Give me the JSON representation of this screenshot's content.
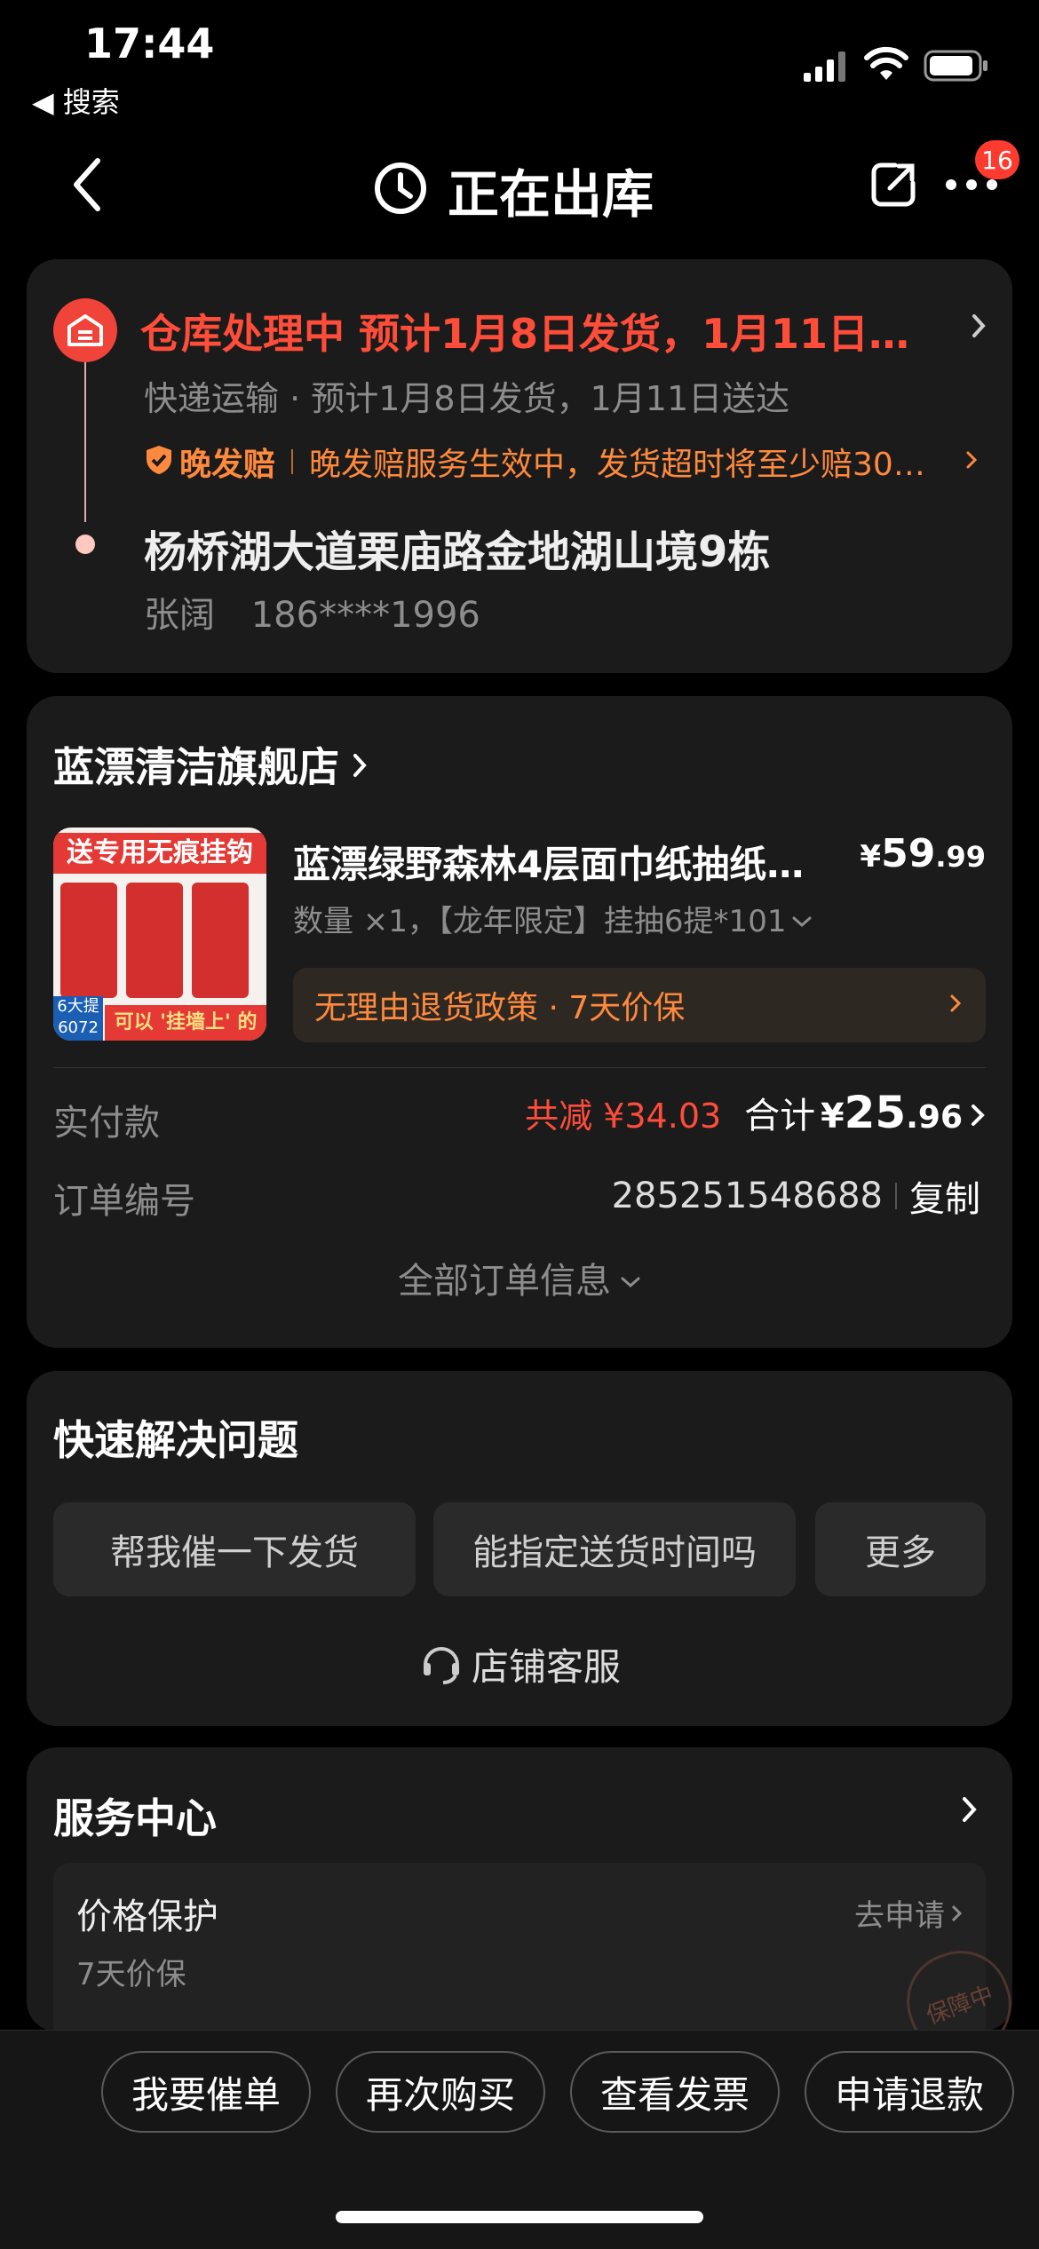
{
  "status_bar": {
    "time": "17:44",
    "back_app": "◀ 搜索"
  },
  "nav": {
    "title": "正在出库",
    "badge": "16"
  },
  "shipping": {
    "status_line": "仓库处理中 预计1月8日发货，1月11日…",
    "express_line": "快递运输 · 预计1月8日发货，1月11日送达",
    "late_tag": "晚发赔",
    "late_text": "晚发赔服务生效中，发货超时将至少赔30…",
    "address": "杨桥湖大道栗庙路金地湖山境9栋",
    "recipient": "张阔",
    "phone": "186****1996"
  },
  "order": {
    "shop_name": "蓝漂清洁旗舰店",
    "product_title": "蓝漂绿野森林4层面巾纸抽纸…",
    "price_symbol": "¥",
    "price_int": "59",
    "price_dec": ".99",
    "spec": "数量 ×1，【龙年限定】挂抽6提*101",
    "service_text": "无理由退货政策 · 7天价保",
    "image_banner": "送专用无痕挂钩",
    "image_tag1": "6大提",
    "image_tag2": "6072",
    "image_caption": "可以 '挂墙上' 的纸",
    "paid_label": "实付款",
    "discount": "共减 ¥34.03",
    "total_label": "合计",
    "total_symbol": "¥",
    "total_int": "25",
    "total_dec": ".96",
    "order_no_label": "订单编号",
    "order_no": "285251548688",
    "copy_label": "复制",
    "all_info": "全部订单信息"
  },
  "quick": {
    "title": "快速解决问题",
    "buttons": [
      "帮我催一下发货",
      "能指定送货时间吗",
      "更多"
    ],
    "service_link": "店铺客服"
  },
  "service_center": {
    "title": "服务中心",
    "item_title": "价格保护",
    "item_sub": "7天价保",
    "item_action": "去申请",
    "stamp": "保障中"
  },
  "bottom_bar": {
    "buttons": [
      "我要催单",
      "再次购买",
      "查看发票",
      "申请退款"
    ]
  },
  "colors": {
    "accent_red": "#ff4d3a",
    "accent_orange": "#ff8a3d",
    "card_bg": "#1b1b1b"
  }
}
